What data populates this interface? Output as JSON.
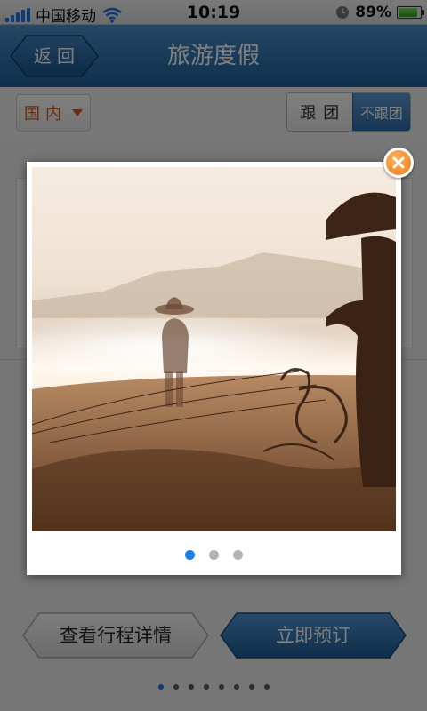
{
  "status_bar": {
    "carrier": "中国移动",
    "time": "10:19",
    "battery_percent": "89",
    "battery_percent_sign": "%",
    "battery_level": 0.89,
    "icons": [
      "signal-icon",
      "wifi-icon",
      "clock-icon",
      "battery-icon"
    ]
  },
  "nav": {
    "back_label": "返回",
    "title": "旅游度假"
  },
  "filter": {
    "region_label": "国内",
    "segment": [
      "跟团",
      "不跟团"
    ],
    "selected_segment": "不跟团"
  },
  "actions": {
    "detail_label": "查看行程详情",
    "book_label": "立即预订"
  },
  "page_dots": {
    "count": 8,
    "active": 0
  },
  "modal": {
    "image": "fisherman-photo",
    "dots": {
      "count": 3,
      "active": 0
    },
    "close_icon": "close-icon"
  },
  "colors": {
    "nav_blue": "#2f6fa8",
    "accent_orange": "#f0791b",
    "region_red": "#d9541c",
    "active_dot": "#1a7fe8"
  }
}
